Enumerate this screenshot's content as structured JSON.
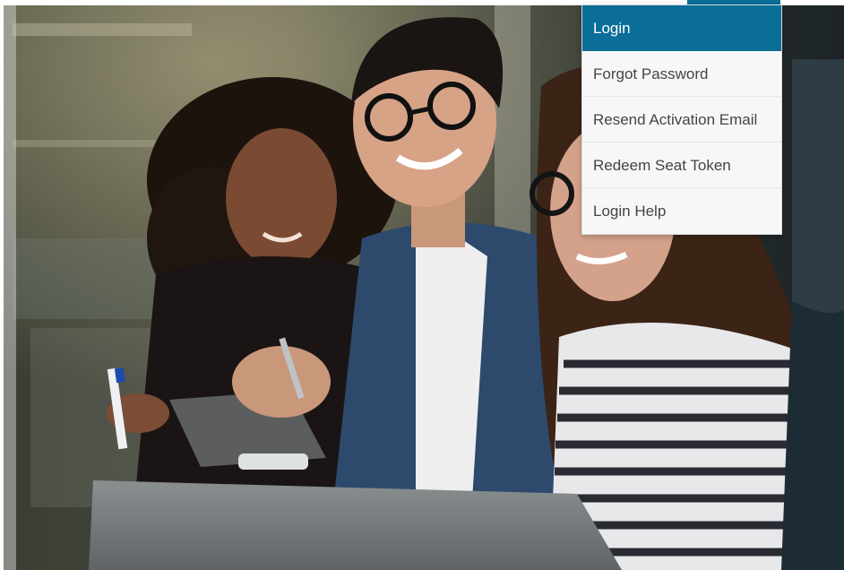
{
  "menu": {
    "items": [
      {
        "label": "Login",
        "active": true
      },
      {
        "label": "Forgot Password",
        "active": false
      },
      {
        "label": "Resend Activation Email",
        "active": false
      },
      {
        "label": "Redeem Seat Token",
        "active": false
      },
      {
        "label": "Login Help",
        "active": false
      }
    ]
  },
  "colors": {
    "accent": "#0b6e99",
    "menu_bg": "#f7f7f7",
    "menu_text": "#444444"
  }
}
